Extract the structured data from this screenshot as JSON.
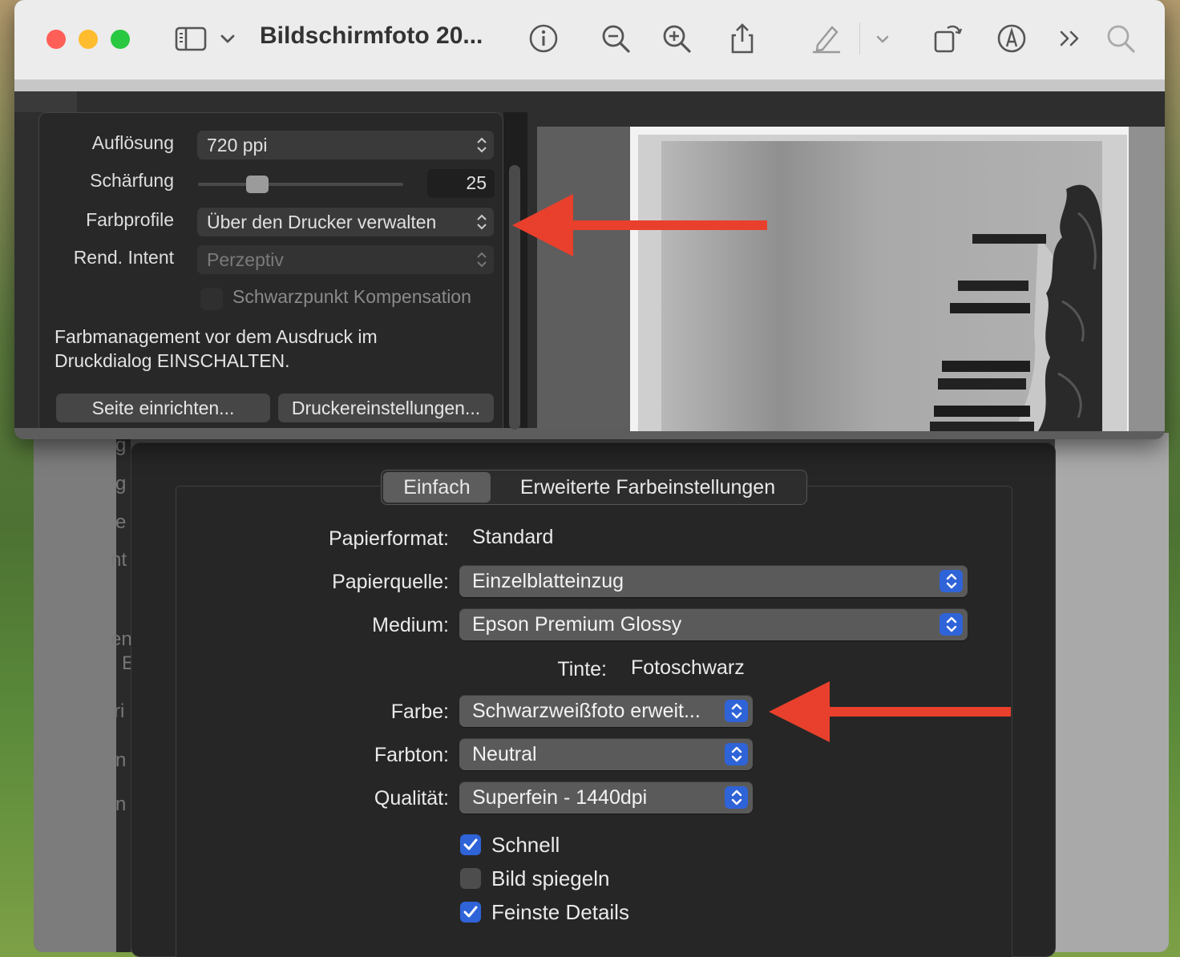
{
  "window": {
    "title": "Bildschirmfoto 20..."
  },
  "toolbar": {
    "icons": [
      "sidebar-icon",
      "chevron-down-icon",
      "info-icon",
      "zoom-out-icon",
      "zoom-in-icon",
      "share-icon",
      "markup-pen-icon",
      "chevron-down-icon",
      "rotate-icon",
      "markup-icon",
      "more-icon",
      "search-icon"
    ]
  },
  "print_panel": {
    "resolution_label": "Auflösung",
    "resolution_value": "720 ppi",
    "sharpening_label": "Schärfung",
    "sharpening_value": "25",
    "sharpening_level": 25,
    "color_profiles_label": "Farbprofile",
    "color_profiles_value": "Über den Drucker verwalten",
    "rendering_intent_label": "Rend. Intent",
    "rendering_intent_value": "Perzeptiv",
    "blackpoint_label": "Schwarzpunkt Kompensation",
    "blackpoint_checked": false,
    "note": "Farbmanagement vor dem Ausdruck im Druckdialog EINSCHALTEN.",
    "page_setup_button": "Seite einrichten...",
    "printer_settings_button": "Druckereinstellungen..."
  },
  "print_dialog": {
    "tabs": [
      "Einfach",
      "Erweiterte Farbeinstellungen"
    ],
    "active_tab": "Einfach",
    "paper_size_label": "Papierformat:",
    "paper_size_value": "Standard",
    "paper_source_label": "Papierquelle:",
    "paper_source_value": "Einzelblatteinzug",
    "media_label": "Medium:",
    "media_value": "Epson Premium Glossy",
    "ink_label": "Tinte:",
    "ink_value": "Fotoschwarz",
    "color_label": "Farbe:",
    "color_value": "Schwarzweißfoto erweit...",
    "tone_label": "Farbton:",
    "tone_value": "Neutral",
    "quality_label": "Qualität:",
    "quality_value": "Superfein - 1440dpi",
    "checkboxes": [
      {
        "label": "Schnell",
        "checked": true
      },
      {
        "label": "Bild spiegeln",
        "checked": false
      },
      {
        "label": "Feinste Details",
        "checked": true
      }
    ]
  },
  "background_fragments": [
    "g",
    "g",
    "e",
    "nt",
    "en",
    "E",
    "ri",
    "n",
    "n"
  ],
  "colors": {
    "accent": "#2f63d8",
    "arrow": "#e8402c",
    "close": "#ff5f57",
    "minimize": "#febc2e",
    "zoom": "#28c840"
  }
}
